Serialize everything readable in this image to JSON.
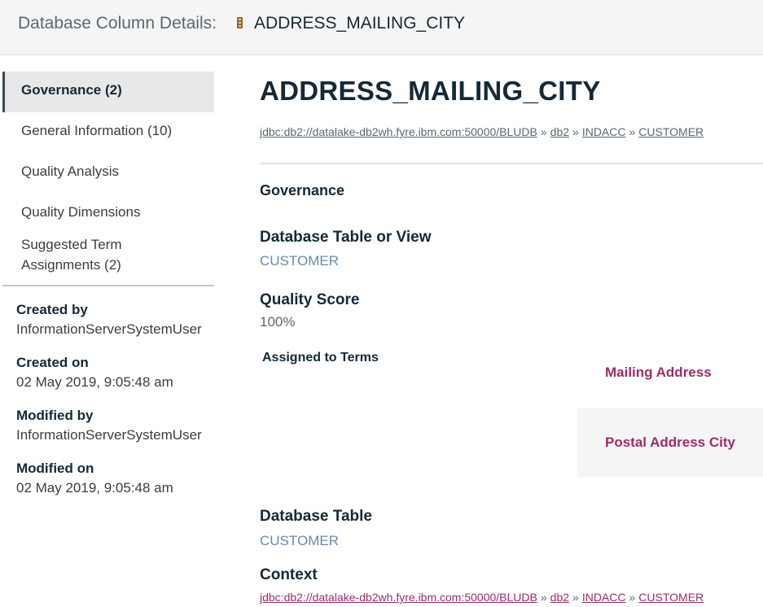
{
  "header": {
    "label": "Database Column Details:",
    "icon": "database-column-icon",
    "name": "ADDRESS_MAILING_CITY"
  },
  "sidebar": {
    "items": [
      {
        "label": "Governance (2)",
        "active": true
      },
      {
        "label": "General Information (10)",
        "active": false
      },
      {
        "label": "Quality Analysis",
        "active": false
      },
      {
        "label": "Quality Dimensions",
        "active": false
      },
      {
        "label": "Suggested Term Assignments (2)",
        "line1": "Suggested Term",
        "line2": "Assignments (2)",
        "active": false
      }
    ],
    "meta": [
      {
        "label": "Created by",
        "value": "InformationServerSystemUser"
      },
      {
        "label": "Created on",
        "value": "02 May 2019, 9:05:48 am"
      },
      {
        "label": "Modified by",
        "value": "InformationServerSystemUser"
      },
      {
        "label": "Modified on",
        "value": "02 May 2019, 9:05:48 am"
      }
    ]
  },
  "main": {
    "title": "ADDRESS_MAILING_CITY",
    "breadcrumb": [
      "jdbc:db2://datalake-db2wh.fyre.ibm.com:50000/BLUDB",
      "db2",
      "INDACC",
      "CUSTOMER"
    ],
    "breadcrumb_sep": "»",
    "section": "Governance",
    "fields": {
      "table_or_view_label": "Database Table or View",
      "table_or_view_value": "CUSTOMER",
      "quality_score_label": "Quality Score",
      "quality_score_value": "100%",
      "assigned_terms_label": "Assigned to Terms",
      "database_table_label": "Database Table",
      "database_table_value": "CUSTOMER",
      "context_label": "Context"
    },
    "terms": [
      "Mailing Address",
      "Postal Address City"
    ],
    "context": [
      "jdbc:db2://datalake-db2wh.fyre.ibm.com:50000/BLUDB",
      "db2",
      "INDACC",
      "CUSTOMER"
    ]
  },
  "colors": {
    "term_link": "#9b2c6e",
    "value_link": "#6a8bab",
    "active_nav_bg": "#e8e8e8"
  }
}
